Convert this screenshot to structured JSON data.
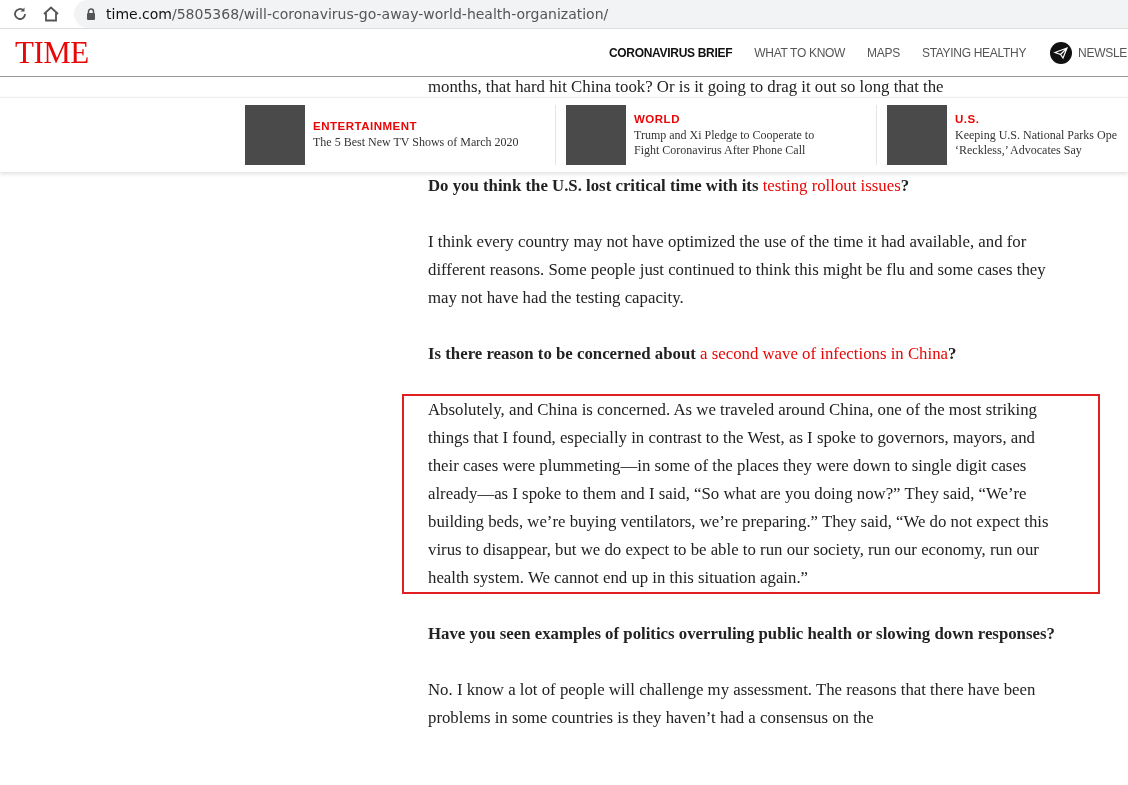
{
  "browser": {
    "url_host": "time.com",
    "url_path": "/5805368/will-coronavirus-go-away-world-health-organization/"
  },
  "header": {
    "logo": "TIME",
    "nav": [
      {
        "label": "CORONAVIRUS BRIEF",
        "selected": true
      },
      {
        "label": "WHAT TO KNOW",
        "selected": false
      },
      {
        "label": "MAPS",
        "selected": false
      },
      {
        "label": "STAYING HEALTHY",
        "selected": false
      },
      {
        "label": "NEWSLE",
        "selected": false,
        "kind": "newsletter"
      }
    ]
  },
  "related": [
    {
      "category": "ENTERTAINMENT",
      "title_lines": [
        "The 5 Best New TV Shows of March 2020"
      ]
    },
    {
      "category": "WORLD",
      "title_lines": [
        "Trump and Xi Pledge to Cooperate to",
        "Fight Coronavirus After Phone Call"
      ]
    },
    {
      "category": "U.S.",
      "title_lines": [
        "Keeping U.S. National Parks Ope",
        "‘Reckless,’ Advocates Say"
      ]
    }
  ],
  "article": {
    "peek_line": "months, that hard hit China took? Or is it going to drag it out so long that the",
    "blocks": [
      {
        "kind": "question",
        "text": "Do you think the U.S. lost critical time with its ",
        "link": "testing rollout issues",
        "after": "?"
      },
      {
        "kind": "answer",
        "highlighted": false,
        "text": "I think every country may not have optimized the use of the time it had available, and for different reasons. Some people just continued to think this might be flu and some cases they may not have had the testing capacity."
      },
      {
        "kind": "question",
        "text": "Is there reason to be concerned about ",
        "link": "a second wave of infections in China",
        "after": "?"
      },
      {
        "kind": "answer",
        "highlighted": true,
        "text": "Absolutely, and China is concerned. As we traveled around China, one of the most striking things that I found, especially in contrast to the West, as I spoke to governors, mayors, and their cases were plummeting—in some of the places they were down to single digit cases already—as I spoke to them and I said, “So what are you doing now?” They said, “We’re building beds, we’re buying ventilators, we’re preparing.” They said, “We do not expect this virus to disappear, but we do expect to be able to run our society, run our economy, run our health system. We cannot end up in this situation again.”"
      },
      {
        "kind": "question",
        "text": "Have you seen examples of politics overruling public health or slowing down responses?"
      },
      {
        "kind": "answer",
        "highlighted": false,
        "text": "No. I know a lot of people will challenge my assessment. The reasons that there have been problems in some countries is they haven’t had a consensus on the"
      }
    ]
  }
}
